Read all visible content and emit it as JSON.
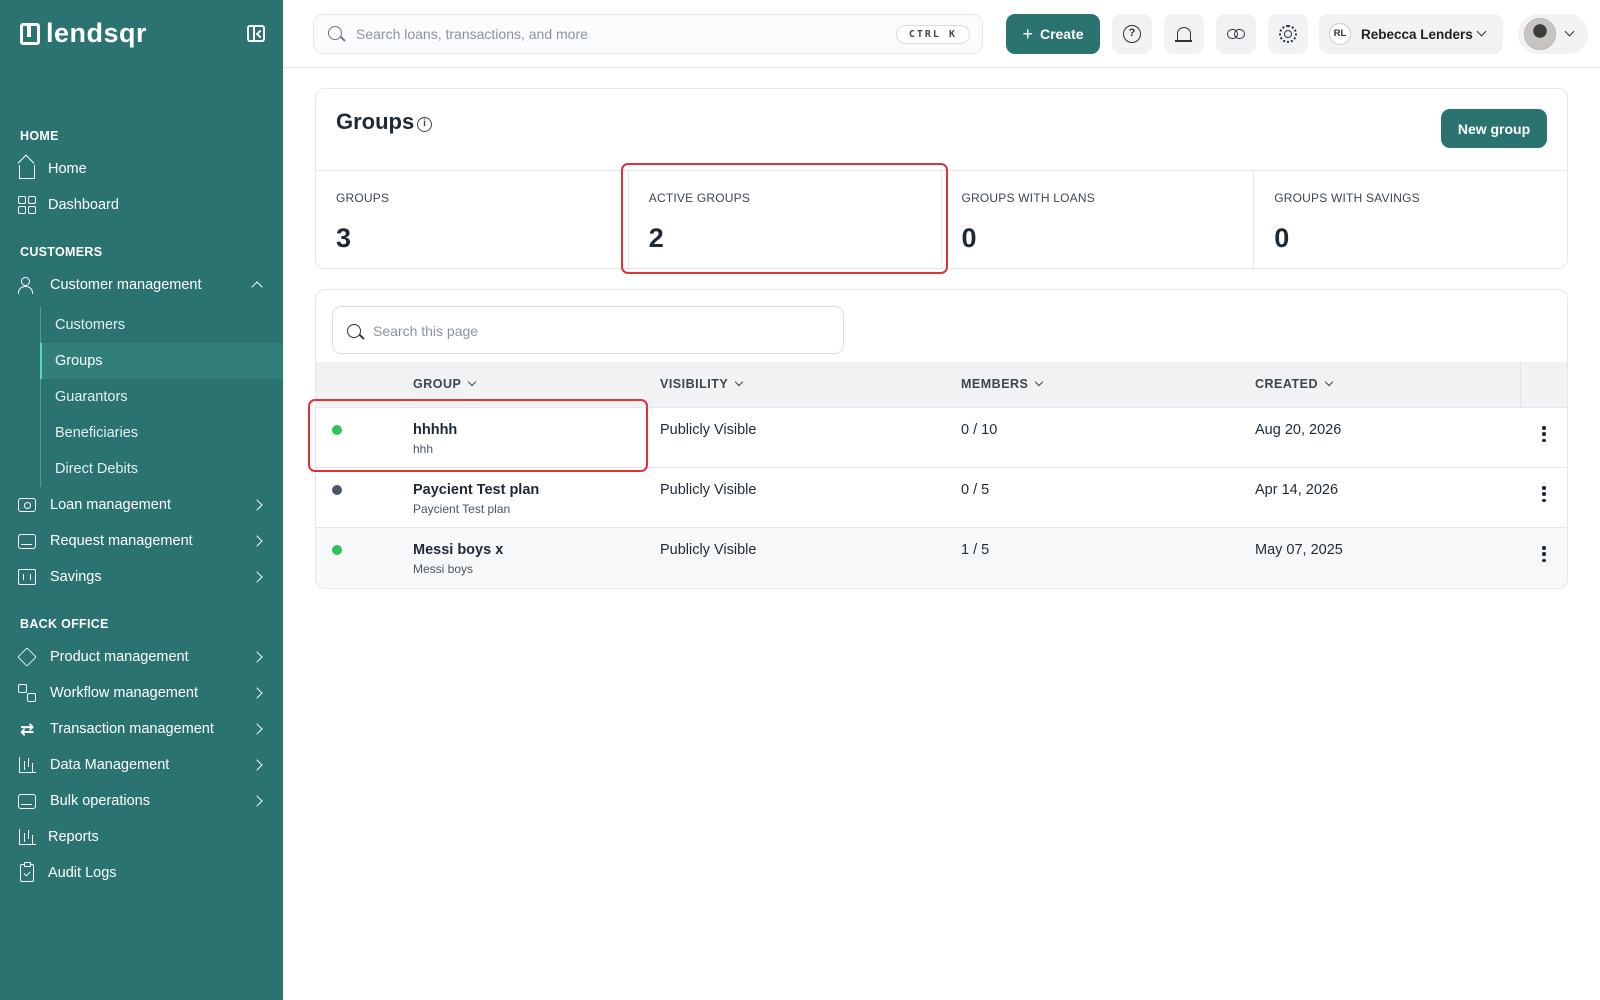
{
  "sidebar": {
    "logo_text": "lendsqr",
    "sections": {
      "home": "HOME",
      "customers": "CUSTOMERS",
      "back_office": "BACK OFFICE"
    },
    "items": {
      "home": "Home",
      "dashboard": "Dashboard",
      "customer_management": "Customer management",
      "customers": "Customers",
      "groups": "Groups",
      "guarantors": "Guarantors",
      "beneficiaries": "Beneficiaries",
      "direct_debits": "Direct Debits",
      "loan_management": "Loan management",
      "request_management": "Request management",
      "savings": "Savings",
      "product_management": "Product management",
      "workflow_management": "Workflow management",
      "transaction_management": "Transaction management",
      "data_management": "Data Management",
      "bulk_operations": "Bulk operations",
      "reports": "Reports",
      "audit_logs": "Audit Logs"
    },
    "active_item": "Groups"
  },
  "topbar": {
    "search_placeholder": "Search loans, transactions, and more",
    "shortcut": "CTRL K",
    "create_label": "Create",
    "user_initials": "RL",
    "user_name": "Rebecca Lenders"
  },
  "page": {
    "title": "Groups",
    "new_group_label": "New group",
    "stats": [
      {
        "label": "GROUPS",
        "value": "3"
      },
      {
        "label": "ACTIVE GROUPS",
        "value": "2"
      },
      {
        "label": "GROUPS WITH LOANS",
        "value": "0"
      },
      {
        "label": "GROUPS WITH SAVINGS",
        "value": "0"
      }
    ],
    "table_search_placeholder": "Search this page",
    "columns": {
      "group": "GROUP",
      "visibility": "VISIBILITY",
      "members": "MEMBERS",
      "created": "CREATED"
    },
    "rows": [
      {
        "name": "hhhhh",
        "description": "hhh",
        "visibility": "Publicly Visible",
        "members": "0 / 10",
        "created": "Aug 20, 2026",
        "status_color": "#2ec45a"
      },
      {
        "name": "Paycient Test plan",
        "description": "Paycient Test plan",
        "visibility": "Publicly Visible",
        "members": "0 / 5",
        "created": "Apr 14, 2026",
        "status_color": "#4a5568"
      },
      {
        "name": "Messi boys x",
        "description": "Messi boys",
        "visibility": "Publicly Visible",
        "members": "1 / 5",
        "created": "May 07, 2025",
        "status_color": "#2ec45a"
      }
    ]
  },
  "colors": {
    "brand": "#2a7370",
    "highlight": "#e0303a"
  }
}
